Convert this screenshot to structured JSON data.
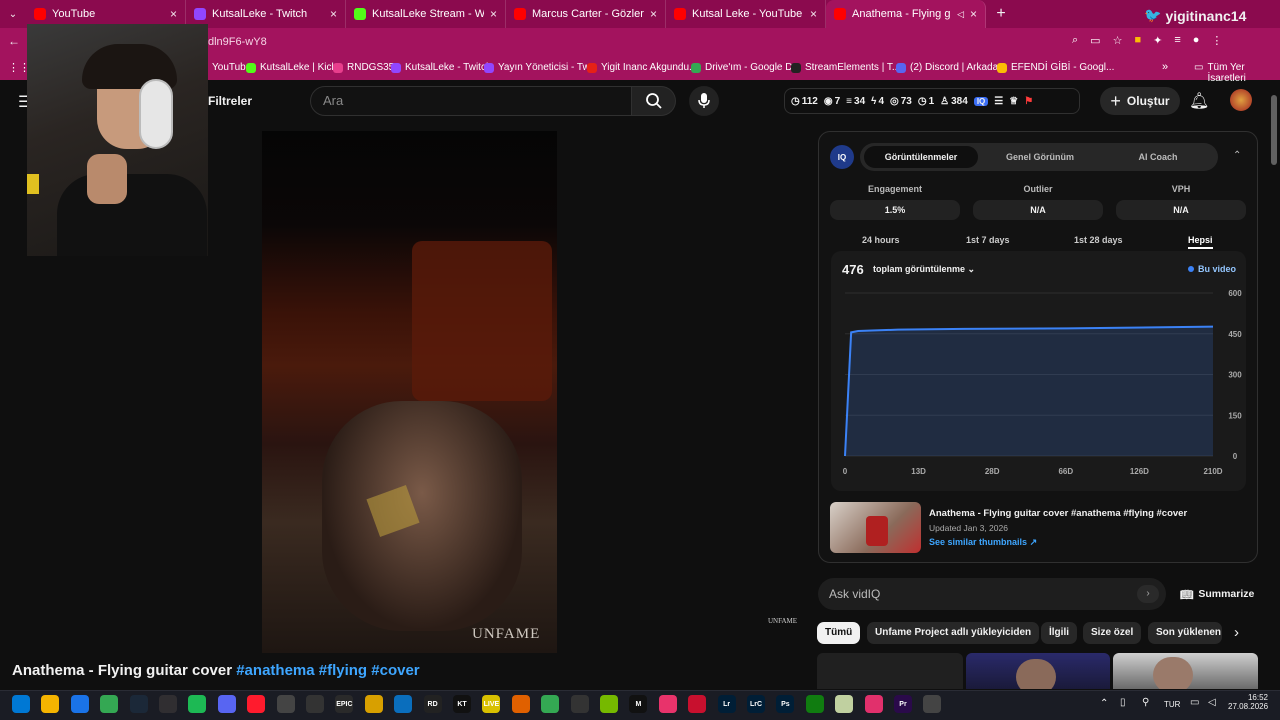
{
  "browser": {
    "tabs": [
      {
        "label": "YouTube",
        "color": "#ff0000"
      },
      {
        "label": "KutsalLeke - Twitch",
        "color": "#9146ff"
      },
      {
        "label": "KutsalLeke Stream - Watch Live",
        "color": "#53fc18"
      },
      {
        "label": "Marcus Carter - Gözler Yalan Sö",
        "color": "#ff0000"
      },
      {
        "label": "Kutsal Leke - YouTube",
        "color": "#ff0000"
      },
      {
        "label": "Anathema - Flying guitar co",
        "color": "#ff0000"
      }
    ],
    "new_tab": "+",
    "profile_name": "yigitinanc14",
    "url_fragment": "dln9F6-wY8",
    "bookmarks": [
      {
        "label": "YouTube",
        "color": "#ff0000"
      },
      {
        "label": "KutsalLeke | Kick",
        "color": "#53fc18"
      },
      {
        "label": "RNDGS35",
        "color": "#e83e8c"
      },
      {
        "label": "KutsalLeke - Twitch",
        "color": "#9146ff"
      },
      {
        "label": "Yayın Yöneticisi - Tw...",
        "color": "#9146ff"
      },
      {
        "label": "Yigit Inanc Akgundu...",
        "color": "#e62117"
      },
      {
        "label": "Drive'ım - Google D...",
        "color": "#34a853"
      },
      {
        "label": "StreamElements | T...",
        "color": "#222222"
      },
      {
        "label": "(2) Discord | Arkada...",
        "color": "#5865f2"
      },
      {
        "label": "EFENDİ GİBİ - Googl...",
        "color": "#fbbc05"
      }
    ],
    "all_bookmarks": "Tüm Yer İşaretleri"
  },
  "youtube": {
    "filters_label": "Filtreler",
    "search_placeholder": "Ara",
    "create_label": "Oluştur",
    "stats": [
      "112",
      "7",
      "34",
      "4",
      "73",
      "1",
      "384"
    ],
    "video_title": "Anathema - Flying guitar cover",
    "hashtags": "#anathema #flying #cover",
    "watermark": "UNFAME",
    "side_watermark": "UNFAME",
    "chips": [
      "Tümü",
      "Unfame Project adlı yükleyiciden",
      "İlgili",
      "Size özel",
      "Son yüklenen"
    ]
  },
  "vidiq": {
    "tabs": [
      "Görüntülenmeler",
      "Genel Görünüm",
      "AI Coach"
    ],
    "metrics": [
      {
        "label": "Engagement",
        "value": "1.5%"
      },
      {
        "label": "Outlier",
        "value": "N/A"
      },
      {
        "label": "VPH",
        "value": "N/A"
      }
    ],
    "ranges": [
      "24 hours",
      "1st 7 days",
      "1st 28 days",
      "Hepsi"
    ],
    "total_views": "476",
    "total_label": "toplam görüntülenme",
    "legend": "Bu video",
    "related_title": "Anathema - Flying guitar cover #anathema #flying #cover",
    "related_updated": "Updated Jan 3, 2026",
    "similar_link": "See similar thumbnails",
    "ask_placeholder": "Ask vidIQ",
    "summarize": "Summarize"
  },
  "chart_data": {
    "type": "area",
    "x_ticks": [
      "0",
      "13D",
      "28D",
      "66D",
      "126D",
      "210D"
    ],
    "y_ticks": [
      "600",
      "450",
      "300",
      "150",
      "0"
    ],
    "ylim": [
      0,
      600
    ],
    "xlim": [
      0,
      210
    ],
    "legend_position": "top-right",
    "series": [
      {
        "name": "Bu video",
        "color": "#3b82f6",
        "x": [
          0,
          1,
          5,
          13,
          28,
          66,
          126,
          210
        ],
        "y": [
          0,
          455,
          460,
          462,
          465,
          468,
          470,
          476
        ]
      }
    ]
  },
  "taskbar": {
    "lang": "TUR",
    "time": "16:52",
    "date": "27.08.2026"
  }
}
